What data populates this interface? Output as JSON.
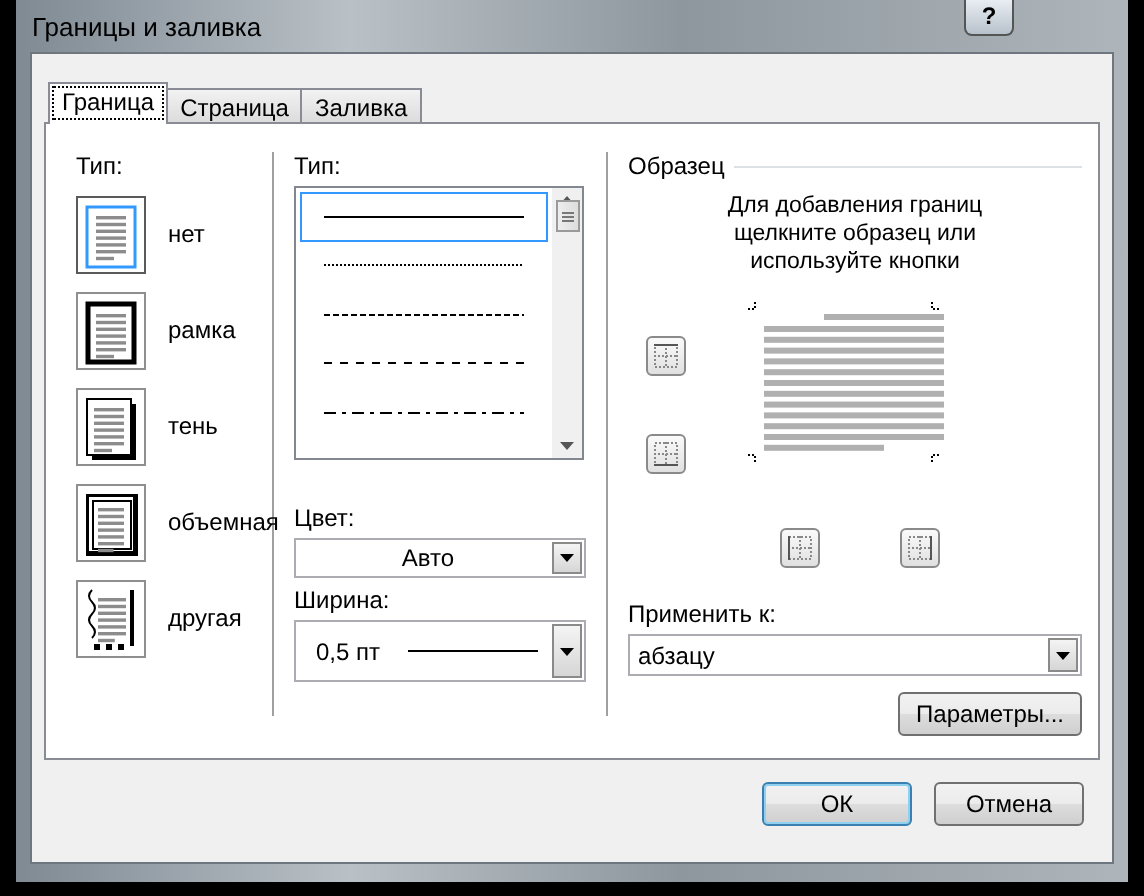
{
  "window": {
    "title": "Границы и заливка",
    "help_button": "?"
  },
  "tabs": [
    {
      "label": "Граница",
      "selected": true
    },
    {
      "label": "Страница",
      "selected": false
    },
    {
      "label": "Заливка",
      "selected": false
    }
  ],
  "setting": {
    "label": "Тип:",
    "items": [
      {
        "label": "нет",
        "kind": "none",
        "selected": true
      },
      {
        "label": "рамка",
        "kind": "box",
        "selected": false
      },
      {
        "label": "тень",
        "kind": "shadow",
        "selected": false
      },
      {
        "label": "объемная",
        "kind": "three-d",
        "selected": false
      },
      {
        "label": "другая",
        "kind": "custom",
        "selected": false
      }
    ]
  },
  "style": {
    "label": "Тип:",
    "lines": [
      {
        "kind": "solid",
        "selected": true
      },
      {
        "kind": "dotted",
        "selected": false
      },
      {
        "kind": "fine-dashed",
        "selected": false
      },
      {
        "kind": "dashed",
        "selected": false
      },
      {
        "kind": "dash-dot",
        "selected": false
      }
    ]
  },
  "color": {
    "label": "Цвет:",
    "value": "Авто"
  },
  "width": {
    "label": "Ширина:",
    "value": "0,5 пт"
  },
  "preview": {
    "title": "Образец",
    "hint": "Для добавления границ щелкните образец или используйте кнопки"
  },
  "apply_to": {
    "label": "Применить к:",
    "value": "абзацу"
  },
  "buttons": [
    {
      "kind": "options",
      "label": "Параметры...",
      "default": false
    },
    {
      "kind": "ok",
      "label": "ОК",
      "default": true
    },
    {
      "kind": "cancel",
      "label": "Отмена",
      "default": false
    }
  ]
}
